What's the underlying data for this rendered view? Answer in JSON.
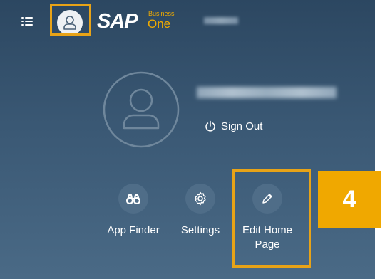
{
  "header": {
    "menu_icon": "hamburger-list-icon",
    "user_icon": "user-icon",
    "logo": {
      "brand": "SAP",
      "product_top": "Business",
      "product_bottom": "One"
    },
    "colors": {
      "logo_accent": "#f0ab00",
      "highlight_frame": "#e8a317"
    }
  },
  "user_panel": {
    "avatar_icon": "user-icon",
    "sign_out_label": "Sign Out",
    "sign_out_icon": "power-icon"
  },
  "actions": [
    {
      "label": "App Finder",
      "icon": "binoculars-icon"
    },
    {
      "label": "Settings",
      "icon": "gear-icon"
    },
    {
      "label": "Edit Home Page",
      "icon": "pencil-icon"
    }
  ],
  "callout": {
    "step_number": "4",
    "color": "#f0a800"
  }
}
